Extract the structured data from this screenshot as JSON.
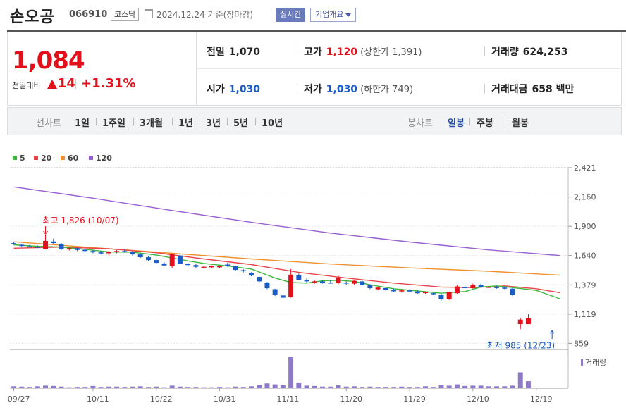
{
  "header": {
    "name": "손오공",
    "code": "066910",
    "market": "코스닥",
    "date": "2024.12.24",
    "basis": "기준(장마감)",
    "realtime_button": "실시간",
    "info_button": "기업개요"
  },
  "summary": {
    "price": "1,084",
    "change_label": "전일대비",
    "change": "14",
    "change_pct": "+1.31%",
    "prev_label": "전일",
    "prev": "1,070",
    "high_label": "고가",
    "high": "1,120",
    "upper_limit": "(상한가 1,391)",
    "volume_label": "거래량",
    "volume": "624,253",
    "open_label": "시가",
    "open": "1,030",
    "low_label": "저가",
    "low": "1,030",
    "lower_limit": "(하한가 749)",
    "value_label": "거래대금",
    "value": "658 백만"
  },
  "periods": {
    "line_label": "선차트",
    "line_items": [
      "1일",
      "1주일",
      "3개월",
      "1년",
      "3년",
      "5년",
      "10년"
    ],
    "candle_label": "봉차트",
    "candle_items": [
      "일봉",
      "주봉",
      "월봉"
    ],
    "selected": "일봉"
  },
  "colors": {
    "up": "#e3101c",
    "down": "#1a5bc4",
    "ma5": "#3cb83c",
    "ma20": "#e8454b",
    "ma60": "#f0912d",
    "ma120": "#9a5fd1",
    "volume": "#8e79c8"
  },
  "chart_data": {
    "type": "candlestick",
    "legend": [
      "5",
      "20",
      "60",
      "120"
    ],
    "yticks": [
      2421,
      2160,
      1900,
      1640,
      1379,
      1119,
      859
    ],
    "ylim": [
      830,
      2421
    ],
    "xticks": [
      "09/27",
      "10/11",
      "10/22",
      "10/31",
      "11/11",
      "11/20",
      "11/29",
      "12/10",
      "12/19"
    ],
    "xtick_index": [
      0,
      10,
      18,
      26,
      34,
      42,
      50,
      58,
      66
    ],
    "high_annotation": "최고 1,826 (10/07)",
    "high_index": 4,
    "low_annotation": "최저 985 (12/23)",
    "low_index": 68,
    "volume_label": "거래량",
    "candles": [
      [
        1750,
        1760,
        1735,
        1740
      ],
      [
        1735,
        1745,
        1720,
        1725
      ],
      [
        1722,
        1735,
        1712,
        1720
      ],
      [
        1718,
        1730,
        1705,
        1712
      ],
      [
        1700,
        1826,
        1695,
        1770
      ],
      [
        1765,
        1790,
        1745,
        1750
      ],
      [
        1745,
        1750,
        1690,
        1695
      ],
      [
        1700,
        1715,
        1685,
        1705
      ],
      [
        1705,
        1712,
        1680,
        1690
      ],
      [
        1690,
        1700,
        1672,
        1680
      ],
      [
        1680,
        1690,
        1660,
        1668
      ],
      [
        1668,
        1680,
        1650,
        1660
      ],
      [
        1660,
        1680,
        1640,
        1675
      ],
      [
        1675,
        1690,
        1660,
        1680
      ],
      [
        1680,
        1695,
        1665,
        1672
      ],
      [
        1672,
        1680,
        1640,
        1650
      ],
      [
        1650,
        1660,
        1620,
        1625
      ],
      [
        1625,
        1635,
        1590,
        1600
      ],
      [
        1600,
        1612,
        1565,
        1575
      ],
      [
        1570,
        1580,
        1545,
        1552
      ],
      [
        1545,
        1660,
        1530,
        1650
      ],
      [
        1640,
        1650,
        1560,
        1565
      ],
      [
        1565,
        1575,
        1540,
        1555
      ],
      [
        1555,
        1565,
        1530,
        1540
      ],
      [
        1540,
        1550,
        1530,
        1540
      ],
      [
        1540,
        1552,
        1530,
        1545
      ],
      [
        1545,
        1552,
        1530,
        1545
      ],
      [
        1560,
        1575,
        1540,
        1548
      ],
      [
        1545,
        1550,
        1505,
        1512
      ],
      [
        1510,
        1520,
        1490,
        1500
      ],
      [
        1485,
        1492,
        1455,
        1462
      ],
      [
        1450,
        1455,
        1400,
        1410
      ],
      [
        1400,
        1405,
        1340,
        1350
      ],
      [
        1340,
        1345,
        1280,
        1290
      ],
      [
        1285,
        1290,
        1260,
        1265
      ],
      [
        1270,
        1520,
        1265,
        1470
      ],
      [
        1465,
        1480,
        1420,
        1425
      ],
      [
        1425,
        1440,
        1400,
        1410
      ],
      [
        1405,
        1420,
        1390,
        1410
      ],
      [
        1410,
        1418,
        1390,
        1395
      ],
      [
        1400,
        1418,
        1390,
        1398
      ],
      [
        1395,
        1460,
        1385,
        1445
      ],
      [
        1400,
        1410,
        1380,
        1395
      ],
      [
        1390,
        1420,
        1380,
        1415
      ],
      [
        1410,
        1418,
        1370,
        1375
      ],
      [
        1375,
        1385,
        1340,
        1350
      ],
      [
        1340,
        1360,
        1330,
        1355
      ],
      [
        1350,
        1360,
        1325,
        1332
      ],
      [
        1335,
        1345,
        1315,
        1322
      ],
      [
        1325,
        1340,
        1310,
        1330
      ],
      [
        1330,
        1340,
        1315,
        1320
      ],
      [
        1320,
        1330,
        1300,
        1305
      ],
      [
        1310,
        1320,
        1300,
        1315
      ],
      [
        1305,
        1310,
        1290,
        1300
      ],
      [
        1290,
        1300,
        1240,
        1250
      ],
      [
        1250,
        1320,
        1245,
        1315
      ],
      [
        1305,
        1375,
        1300,
        1365
      ],
      [
        1360,
        1375,
        1345,
        1350
      ],
      [
        1350,
        1390,
        1345,
        1380
      ],
      [
        1375,
        1390,
        1355,
        1362
      ],
      [
        1360,
        1370,
        1350,
        1362
      ],
      [
        1360,
        1370,
        1345,
        1355
      ],
      [
        1355,
        1362,
        1340,
        1345
      ],
      [
        1345,
        1350,
        1280,
        1290
      ],
      [
        1030,
        1085,
        985,
        1070
      ],
      [
        1030,
        1120,
        1030,
        1084
      ]
    ],
    "candle_index": [
      0,
      1,
      2,
      3,
      4,
      5,
      6,
      7,
      8,
      9,
      10,
      11,
      12,
      13,
      14,
      15,
      16,
      17,
      18,
      19,
      20,
      21,
      22,
      23,
      24,
      25,
      26,
      27,
      28,
      29,
      30,
      31,
      32,
      33,
      34,
      35,
      36,
      37,
      38,
      39,
      40,
      41,
      42,
      43,
      44,
      45,
      46,
      47,
      48,
      49,
      50,
      51,
      52,
      53,
      54,
      55,
      56,
      57,
      58,
      59,
      60,
      61,
      62,
      63,
      64,
      65,
      68,
      69
    ],
    "volumes": [
      6,
      5,
      4,
      6,
      8,
      7,
      5,
      3,
      4,
      4,
      7,
      4,
      5,
      5,
      4,
      5,
      6,
      4,
      5,
      3,
      8,
      5,
      4,
      4,
      3,
      3,
      4,
      3,
      5,
      4,
      6,
      10,
      15,
      12,
      9,
      100,
      18,
      8,
      7,
      5,
      5,
      10,
      5,
      6,
      4,
      5,
      4,
      4,
      4,
      5,
      4,
      4,
      6,
      4,
      10,
      8,
      12,
      7,
      8,
      8,
      6,
      6,
      6,
      8,
      50,
      22
    ],
    "ma5": [
      [
        0,
        1735
      ],
      [
        3,
        1722
      ],
      [
        6,
        1715
      ],
      [
        9,
        1695
      ],
      [
        12,
        1672
      ],
      [
        15,
        1670
      ],
      [
        18,
        1645
      ],
      [
        21,
        1605
      ],
      [
        24,
        1570
      ],
      [
        27,
        1548
      ],
      [
        30,
        1520
      ],
      [
        33,
        1440
      ],
      [
        35,
        1400
      ],
      [
        37,
        1395
      ],
      [
        39,
        1415
      ],
      [
        41,
        1420
      ],
      [
        43,
        1410
      ],
      [
        45,
        1380
      ],
      [
        48,
        1345
      ],
      [
        51,
        1325
      ],
      [
        54,
        1305
      ],
      [
        57,
        1320
      ],
      [
        59,
        1360
      ],
      [
        61,
        1370
      ],
      [
        63,
        1355
      ],
      [
        66,
        1330
      ],
      [
        69,
        1255
      ]
    ],
    "ma20": [
      [
        0,
        1705
      ],
      [
        6,
        1715
      ],
      [
        12,
        1700
      ],
      [
        18,
        1665
      ],
      [
        24,
        1610
      ],
      [
        30,
        1560
      ],
      [
        36,
        1490
      ],
      [
        42,
        1440
      ],
      [
        48,
        1395
      ],
      [
        54,
        1360
      ],
      [
        58,
        1355
      ],
      [
        62,
        1370
      ],
      [
        66,
        1345
      ],
      [
        69,
        1310
      ]
    ],
    "ma60": [
      [
        0,
        1762
      ],
      [
        10,
        1710
      ],
      [
        20,
        1660
      ],
      [
        30,
        1610
      ],
      [
        40,
        1565
      ],
      [
        50,
        1530
      ],
      [
        60,
        1500
      ],
      [
        69,
        1465
      ]
    ],
    "ma120": [
      [
        0,
        2250
      ],
      [
        10,
        2150
      ],
      [
        20,
        2040
      ],
      [
        30,
        1935
      ],
      [
        40,
        1840
      ],
      [
        50,
        1760
      ],
      [
        60,
        1690
      ],
      [
        69,
        1640
      ]
    ]
  }
}
